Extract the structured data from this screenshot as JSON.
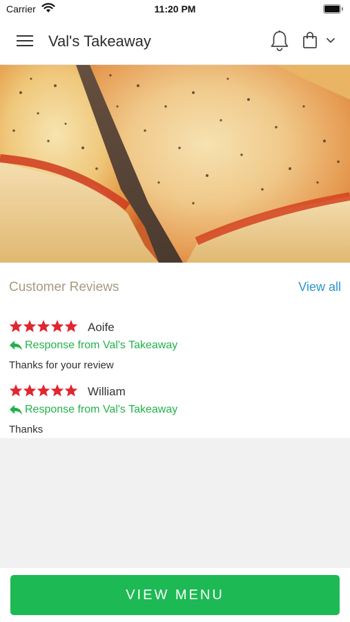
{
  "status_bar": {
    "carrier": "Carrier",
    "time": "11:20 PM"
  },
  "header": {
    "title": "Val's Takeaway"
  },
  "icons": {
    "menu": "hamburger-menu-icon",
    "notifications": "bell-icon",
    "cart": "shopping-bag-icon",
    "dropdown": "chevron-down-icon",
    "reply": "reply-arrow-icon",
    "rating": "star-icon"
  },
  "hero": {
    "subject": "pizza slices photo"
  },
  "reviews": {
    "title": "Customer Reviews",
    "view_all": "View all",
    "items": [
      {
        "name": "Aoife",
        "stars": 5,
        "response": "Response from Val's Takeaway",
        "text": "Thanks for your review"
      },
      {
        "name": "William",
        "stars": 5,
        "response": "Response from Val's Takeaway",
        "text": "Thanks"
      }
    ]
  },
  "footer": {
    "button_label": "VIEW MENU"
  },
  "colors": {
    "accent_green": "#1db954",
    "response_green": "#22b24c",
    "star_red": "#e0262f",
    "link_blue": "#2a97c9",
    "section_title": "#a89a82"
  }
}
